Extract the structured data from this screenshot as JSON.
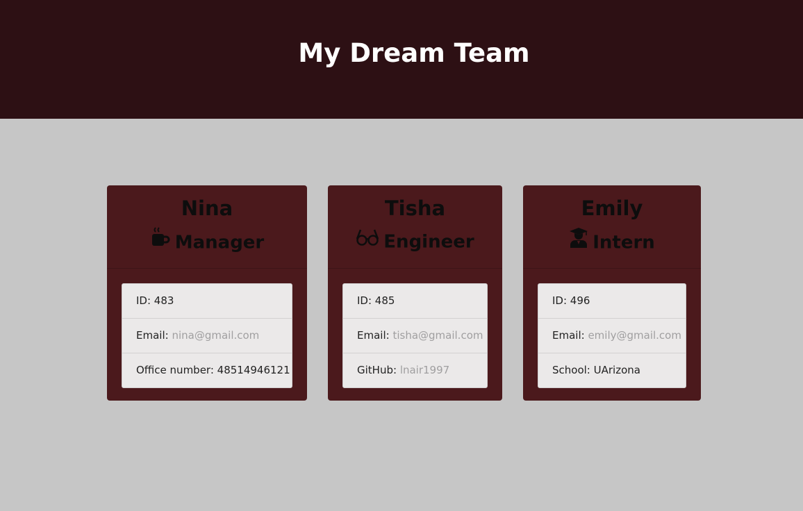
{
  "header": {
    "title": "My Dream Team"
  },
  "team": [
    {
      "name": "Nina",
      "role": "Manager",
      "role_icon": "coffee-mug-icon",
      "id_label": "ID: 483",
      "email_label": "Email: ",
      "email": "nina@gmail.com",
      "extra_label": "Office number: 48514946121",
      "extra_link": ""
    },
    {
      "name": "Tisha",
      "role": "Engineer",
      "role_icon": "glasses-icon",
      "id_label": "ID: 485",
      "email_label": "Email: ",
      "email": "tisha@gmail.com",
      "extra_label": "GitHub: ",
      "extra_link": "lnair1997"
    },
    {
      "name": "Emily",
      "role": "Intern",
      "role_icon": "graduate-icon",
      "id_label": "ID: 496",
      "email_label": "Email: ",
      "email": "emily@gmail.com",
      "extra_label": "School: UArizona",
      "extra_link": ""
    }
  ],
  "colors": {
    "header_bg": "#2d1014",
    "page_bg": "#c6c6c6",
    "card_bg": "#4b191c",
    "list_bg": "#ebe9e9",
    "link_text": "#a09fa0"
  }
}
